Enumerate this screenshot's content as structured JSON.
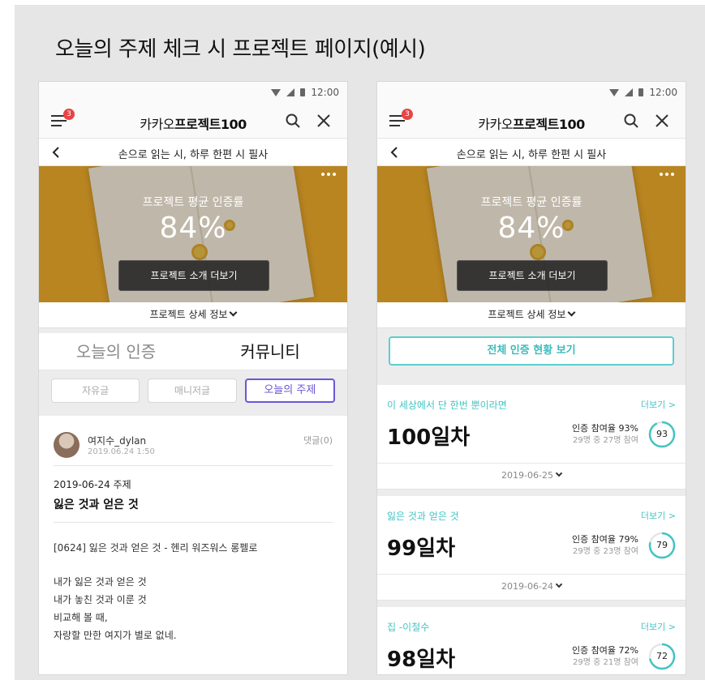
{
  "page_title": "오늘의 주제 체크 시 프로젝트 페이지(예시)",
  "status_time": "12:00",
  "app": {
    "menu_badge": "3",
    "title_pre": "카카오",
    "title_main": "프로젝트100",
    "project_name": "손으로 읽는 시, 하루 한편 시 필사"
  },
  "hero": {
    "label": "프로젝트 평균 인증률",
    "value": "84%",
    "button": "프로젝트 소개 더보기",
    "detail": "프로젝트 상세 정보"
  },
  "left": {
    "tabs": [
      "오늘의 인증",
      "커뮤니티"
    ],
    "chips": [
      "자유글",
      "매니저글",
      "오늘의 주제"
    ],
    "post": {
      "author": "여지수_dylan",
      "date": "2019.06.24 1:50",
      "comments": "댓글(0)",
      "topic_date": "2019-06-24 주제",
      "topic_title": "잃은 것과 얻은 것",
      "heading": "[0624] 잃은 것과 얻은 것 - 헨리 워즈워스 롱펠로",
      "lines": [
        "내가 잃은 것과 얻은 것",
        "내가 놓친 것과 이룬 것",
        "비교해 볼 때,",
        "자랑할 만한 여지가 별로 없네."
      ]
    }
  },
  "right": {
    "overview_button": "전체 인증 현황 보기",
    "more_label": "더보기 >",
    "cards": [
      {
        "topic": "이 세상에서 단 한번 뿐이라면",
        "day": "100일차",
        "rate": "인증 참여율 93%",
        "count": "29명 중 27명 참여",
        "pct": 93,
        "date": "2019-06-25"
      },
      {
        "topic": "잃은 것과 얻은 것",
        "day": "99일차",
        "rate": "인증 참여율 79%",
        "count": "29명 중 23명 참여",
        "pct": 79,
        "date": "2019-06-24"
      },
      {
        "topic": "집 -이철수",
        "day": "98일차",
        "rate": "인증 참여율 72%",
        "count": "29명 중 21명 참여",
        "pct": 72,
        "date": ""
      }
    ]
  },
  "colors": {
    "accent_teal": "#43c4c4",
    "accent_purple": "#6b56d6",
    "badge_red": "#e64545",
    "hero_yellow": "#e8a92a"
  }
}
